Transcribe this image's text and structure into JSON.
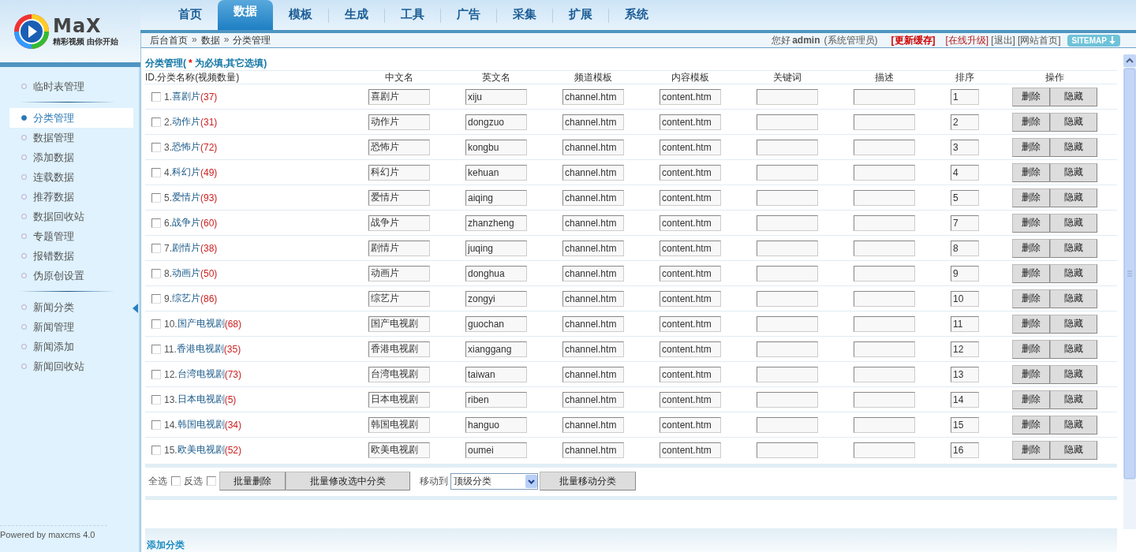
{
  "logo": {
    "wordmark": "MaX",
    "slogan": "精彩视频 由你开始"
  },
  "nav": [
    {
      "label": "首页",
      "selected": false
    },
    {
      "label": "数据",
      "selected": true
    },
    {
      "label": "模板",
      "selected": false
    },
    {
      "label": "生成",
      "selected": false
    },
    {
      "label": "工具",
      "selected": false
    },
    {
      "label": "广告",
      "selected": false
    },
    {
      "label": "采集",
      "selected": false
    },
    {
      "label": "扩展",
      "selected": false
    },
    {
      "label": "系统",
      "selected": false
    }
  ],
  "breadcrumb": [
    {
      "label": "后台首页"
    },
    {
      "separator": "»",
      "label": "数据"
    },
    {
      "separator": "»",
      "label": "分类管理"
    }
  ],
  "user_bar": {
    "greeting": "您好",
    "user": "admin",
    "role": "(系统管理员)",
    "links": [
      {
        "label": "[更新缓存]",
        "kind": "strong"
      },
      {
        "label": "[在线升级]",
        "kind": "red"
      },
      {
        "label": "[退出]",
        "kind": "plain"
      },
      {
        "label": "[网站首页]",
        "kind": "plain"
      }
    ],
    "sitemap": "SITEMAP"
  },
  "sidebar": {
    "groups": [
      [
        {
          "label": "临时表管理",
          "selected": false
        }
      ],
      [
        {
          "label": "分类管理",
          "selected": true
        },
        {
          "label": "数据管理",
          "selected": false
        },
        {
          "label": "添加数据",
          "selected": false
        },
        {
          "label": "连载数据",
          "selected": false
        },
        {
          "label": "推荐数据",
          "selected": false
        },
        {
          "label": "数据回收站",
          "selected": false
        },
        {
          "label": "专题管理",
          "selected": false
        },
        {
          "label": "报错数据",
          "selected": false
        },
        {
          "label": "伪原创设置",
          "selected": false
        }
      ],
      [
        {
          "label": "新闻分类",
          "selected": false
        },
        {
          "label": "新闻管理",
          "selected": false
        },
        {
          "label": "新闻添加",
          "selected": false
        },
        {
          "label": "新闻回收站",
          "selected": false
        }
      ]
    ],
    "footer": "Powered by maxcms 4.0"
  },
  "panel": {
    "title": "分类管理(",
    "required_mark": "*",
    "title_rest": "为必填,其它选填)",
    "columns": [
      "ID.分类名称(视频数量)",
      "中文名",
      "英文名",
      "频道模板",
      "内容模板",
      "关键词",
      "描述",
      "排序",
      "操作"
    ],
    "rows": [
      {
        "id": "1.",
        "name": "喜剧片",
        "count": "(37)",
        "checked": false,
        "cn": "喜剧片",
        "en": "xiju",
        "channel": "channel.htm",
        "content": "content.htm",
        "order": "1"
      },
      {
        "id": "2.",
        "name": "动作片",
        "count": "(31)",
        "checked": false,
        "cn": "动作片",
        "en": "dongzuo",
        "channel": "channel.htm",
        "content": "content.htm",
        "order": "2"
      },
      {
        "id": "3.",
        "name": "恐怖片",
        "count": "(72)",
        "checked": false,
        "cn": "恐怖片",
        "en": "kongbu",
        "channel": "channel.htm",
        "content": "content.htm",
        "order": "3"
      },
      {
        "id": "4.",
        "name": "科幻片",
        "count": "(49)",
        "checked": false,
        "cn": "科幻片",
        "en": "kehuan",
        "channel": "channel.htm",
        "content": "content.htm",
        "order": "4"
      },
      {
        "id": "5.",
        "name": "爱情片",
        "count": "(93)",
        "checked": false,
        "cn": "爱情片",
        "en": "aiqing",
        "channel": "channel.htm",
        "content": "content.htm",
        "order": "5"
      },
      {
        "id": "6.",
        "name": "战争片",
        "count": "(60)",
        "checked": false,
        "cn": "战争片",
        "en": "zhanzheng",
        "channel": "channel.htm",
        "content": "content.htm",
        "order": "7"
      },
      {
        "id": "7.",
        "name": "剧情片",
        "count": "(38)",
        "checked": false,
        "cn": "剧情片",
        "en": "juqing",
        "channel": "channel.htm",
        "content": "content.htm",
        "order": "8"
      },
      {
        "id": "8.",
        "name": "动画片",
        "count": "(50)",
        "checked": false,
        "cn": "动画片",
        "en": "donghua",
        "channel": "channel.htm",
        "content": "content.htm",
        "order": "9"
      },
      {
        "id": "9.",
        "name": "综艺片",
        "count": "(86)",
        "checked": false,
        "cn": "综艺片",
        "en": "zongyi",
        "channel": "channel.htm",
        "content": "content.htm",
        "order": "10"
      },
      {
        "id": "10.",
        "name": "国产电视剧",
        "count": "(68)",
        "checked": false,
        "cn": "国产电视剧",
        "en": "guochan",
        "channel": "channel.htm",
        "content": "content.htm",
        "order": "11"
      },
      {
        "id": "11.",
        "name": "香港电视剧",
        "count": "(35)",
        "checked": false,
        "cn": "香港电视剧",
        "en": "xianggang",
        "channel": "channel.htm",
        "content": "content.htm",
        "order": "12"
      },
      {
        "id": "12.",
        "name": "台湾电视剧",
        "count": "(73)",
        "checked": false,
        "cn": "台湾电视剧",
        "en": "taiwan",
        "channel": "channel.htm",
        "content": "content.htm",
        "order": "13"
      },
      {
        "id": "13.",
        "name": "日本电视剧",
        "count": "(5)",
        "checked": false,
        "cn": "日本电视剧",
        "en": "riben",
        "channel": "channel.htm",
        "content": "content.htm",
        "order": "14"
      },
      {
        "id": "14.",
        "name": "韩国电视剧",
        "count": "(34)",
        "checked": false,
        "cn": "韩国电视剧",
        "en": "hanguo",
        "channel": "channel.htm",
        "content": "content.htm",
        "order": "15"
      },
      {
        "id": "15.",
        "name": "欧美电视剧",
        "count": "(52)",
        "checked": false,
        "cn": "欧美电视剧",
        "en": "oumei",
        "channel": "channel.htm",
        "content": "content.htm",
        "order": "16"
      }
    ],
    "row_actions": [
      [
        "删除",
        "隐藏"
      ],
      [
        "删除",
        "隐藏"
      ],
      [
        "删除",
        "隐藏"
      ],
      [
        "删除",
        "隐藏"
      ],
      [
        "删除",
        "隐藏"
      ],
      [
        "删除",
        "隐藏"
      ],
      [
        "删除",
        "隐藏"
      ],
      [
        "删除",
        "隐藏"
      ],
      [
        "删除",
        "隐藏"
      ],
      [
        "删除",
        "隐藏"
      ],
      [
        "删除",
        "隐藏"
      ],
      [
        "删除",
        "隐藏"
      ],
      [
        "删除",
        "隐藏"
      ],
      [
        "删除",
        "隐藏"
      ],
      [
        "删除",
        "隐藏"
      ]
    ],
    "bulk": {
      "select_all": {
        "label": "全选",
        "checked": false
      },
      "invert": {
        "label": "反选",
        "checked": false
      },
      "buttons": [
        "批量删除",
        "批量修改选中分类"
      ],
      "move_label": "移动到",
      "move_target": "顶级分类",
      "move_button": "批量移动分类"
    }
  },
  "add_section": {
    "title": "添加分类"
  }
}
